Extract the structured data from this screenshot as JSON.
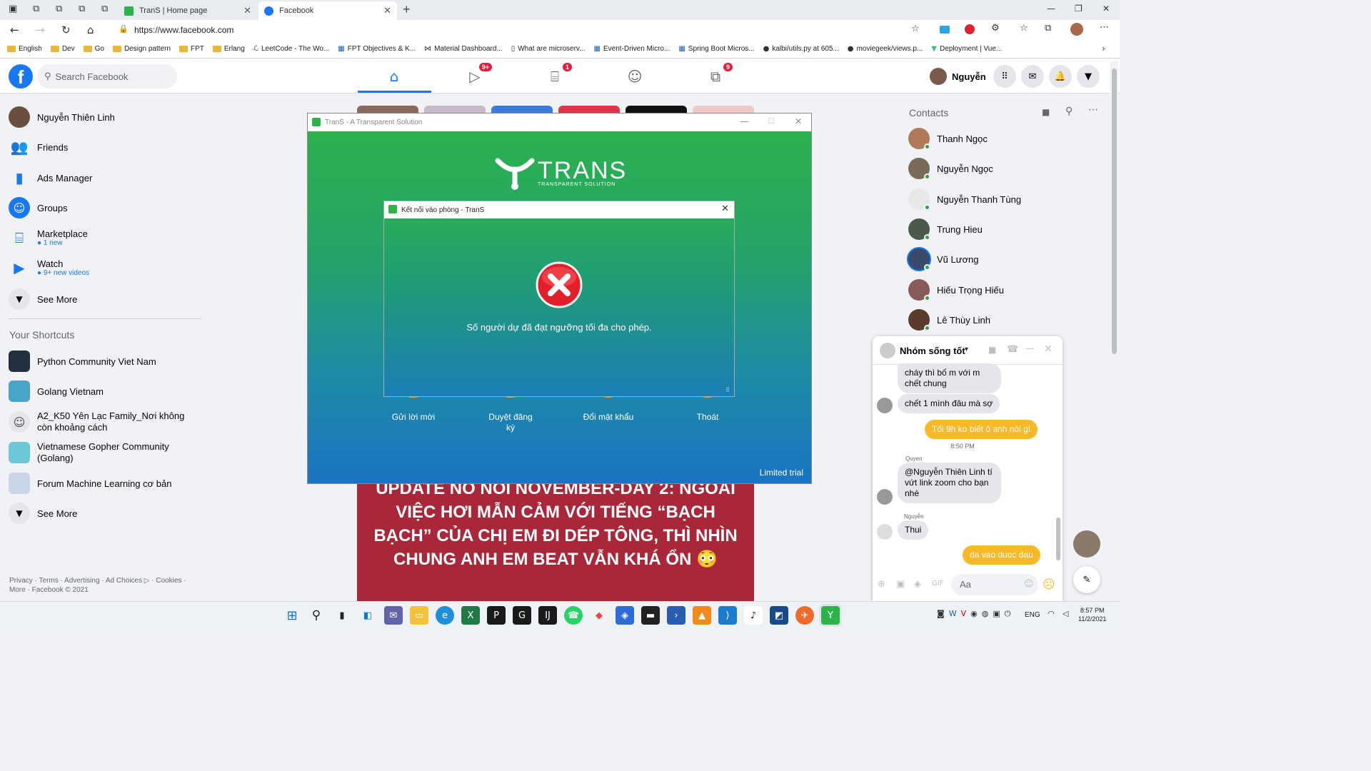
{
  "browser": {
    "tabs": [
      {
        "title": "TranS | Home page",
        "active": false
      },
      {
        "title": "Facebook",
        "active": true
      }
    ],
    "new_tab_symbol": "+",
    "url": "https://www.facebook.com",
    "bookmarks": [
      "English",
      "Dev",
      "Go",
      "Design pattern",
      "FPT",
      "Erlang",
      "LeetCode - The Wo...",
      "FPT Objectives & K...",
      "Material Dashboard...",
      "What are microserv...",
      "Event-Driven Micro...",
      "Spring Boot Micros...",
      "kalbi/utils.py at 605...",
      "moviegeek/views.p...",
      "Deployment | Vue..."
    ]
  },
  "facebook": {
    "search_placeholder": "Search Facebook",
    "nav_badges": {
      "watch": "9+",
      "marketplace": "1",
      "gaming": "9"
    },
    "profile_name": "Nguyễn",
    "sidebar": {
      "user": "Nguyễn Thiên Linh",
      "items": [
        {
          "label": "Friends",
          "sub": ""
        },
        {
          "label": "Ads Manager",
          "sub": ""
        },
        {
          "label": "Groups",
          "sub": ""
        },
        {
          "label": "Marketplace",
          "sub": "1 new"
        },
        {
          "label": "Watch",
          "sub": "9+ new videos"
        },
        {
          "label": "See More",
          "sub": ""
        }
      ],
      "shortcuts_title": "Your Shortcuts",
      "shortcuts": [
        "Python Community Viet Nam",
        "Golang Vietnam",
        "A2_K50 Yên Lạc Family_Nơi không còn khoảng cách",
        "Vietnamese Gopher Community (Golang)",
        "Forum Machine Learning cơ bản"
      ],
      "see_more": "See More",
      "footer_line1": "Privacy · Terms · Advertising · Ad Choices ▷ · Cookies ·",
      "footer_line2": "More · Facebook © 2021"
    },
    "post_text": "UPDATE NỖ NỒI NOVEMBER-DAY 2: NGOÀI VIỆC HƠI MẪN CẢM VỚI TIẾNG “BẠCH BẠCH” CỦA CHỊ EM ĐI DÉP TÔNG, THÌ NHÌN CHUNG ANH EM BEAT VẪN KHÁ ỔN 😳",
    "contacts_title": "Contacts",
    "contacts": [
      "Thanh Ngọc",
      "Nguyễn Ngọc",
      "Nguyễn Thanh Tùng",
      "Trung Hieu",
      "Vũ Lương",
      "Hiếu Trọng Hiếu",
      "Lê Thùy Linh"
    ]
  },
  "chat": {
    "title": "Nhóm sống tốt",
    "messages": {
      "m1": "cháy thì bố m với m chết chung",
      "m2": "chết 1 mình đâu mà sợ",
      "m3": "Tối 9h ko biết ô anh nói gì",
      "time": "8:50 PM",
      "sender1": "Quyen",
      "m4": "@Nguyễn Thiên Linh tí vứt link zoom cho bạn nhé",
      "sender2": "Nguyễn",
      "m5": "Thui",
      "m6": "da vao duoc dau"
    },
    "input_placeholder": "Aa"
  },
  "trans_window": {
    "title": "TranS - A Transparent Solution",
    "logo_text": "TRANS",
    "logo_tagline": "TRANSPARENT SOLUTION",
    "buttons": [
      "Gửi lời mời",
      "Duyệt đăng ký",
      "Đổi mật khẩu",
      "Thoát"
    ],
    "license": "Limited trial"
  },
  "dialog": {
    "title": "Kết nối vào phòng - TranS",
    "message": "Số người dự đã đạt ngưỡng tối đa cho phép."
  },
  "taskbar": {
    "language": "ENG",
    "time": "8:57 PM",
    "date": "11/2/2021"
  },
  "colors": {
    "fb_blue": "#1877f2",
    "trans_green": "#2db34a",
    "trans_blue": "#1a74c2",
    "error_red": "#e41e2a",
    "chat_orange": "#f7b928"
  }
}
